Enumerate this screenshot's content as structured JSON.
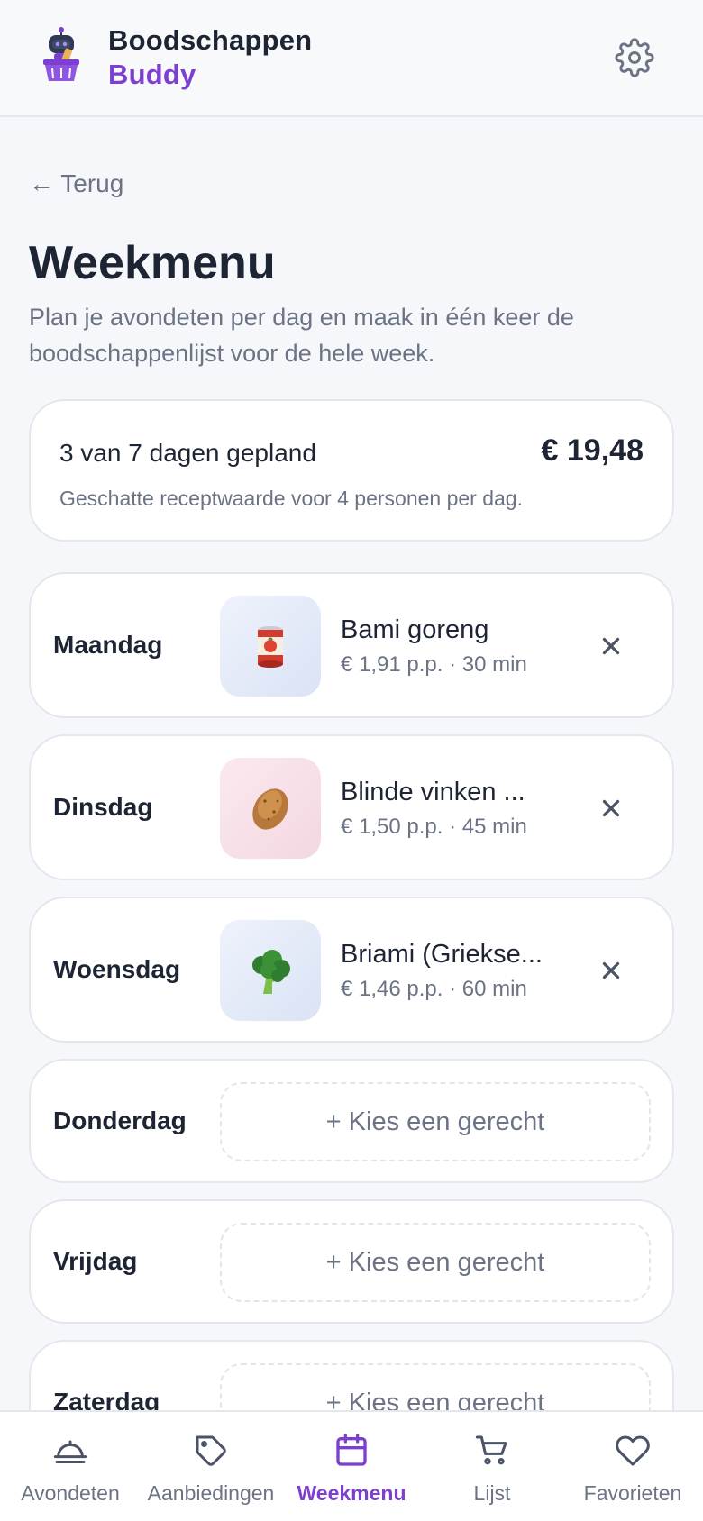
{
  "header": {
    "brand_line1": "Boodschappen",
    "brand_line2": "Buddy",
    "logo_icon": "robot-basket-logo",
    "settings_icon": "gear-icon"
  },
  "page": {
    "back_label": "← Terug",
    "title": "Weekmenu",
    "subtitle": "Plan je avondeten per dag en maak in één keer de boodschappenlijst voor de hele week."
  },
  "summary": {
    "planned": "3 van 7 dagen gepland",
    "total": "€ 19,48",
    "note": "Geschatte receptwaarde voor 4 personen per dag."
  },
  "days": [
    {
      "day": "Maandag",
      "recipe": "Bami goreng",
      "meta": "€ 1,91 p.p. · 30 min",
      "icon": "tomato-can-icon"
    },
    {
      "day": "Dinsdag",
      "recipe": "Blinde vinken ...",
      "meta": "€ 1,50 p.p. · 45 min",
      "icon": "potato-icon"
    },
    {
      "day": "Woensdag",
      "recipe": "Briami (Griekse...",
      "meta": "€ 1,46 p.p. · 60 min",
      "icon": "broccoli-icon"
    },
    {
      "day": "Donderdag",
      "pick_label": "+ Kies een gerecht"
    },
    {
      "day": "Vrijdag",
      "pick_label": "+ Kies een gerecht"
    },
    {
      "day": "Zaterdag",
      "pick_label": "+ Kies een gerecht"
    }
  ],
  "nav": [
    {
      "label": "Avondeten",
      "icon": "cloche-icon"
    },
    {
      "label": "Aanbiedingen",
      "icon": "tag-icon"
    },
    {
      "label": "Weekmenu",
      "icon": "calendar-icon",
      "active": true
    },
    {
      "label": "Lijst",
      "icon": "cart-icon"
    },
    {
      "label": "Favorieten",
      "icon": "heart-icon"
    }
  ],
  "colors": {
    "accent": "#7c3fd1",
    "text": "#1d2433",
    "muted": "#6b7384",
    "border": "#e4e7ec"
  }
}
